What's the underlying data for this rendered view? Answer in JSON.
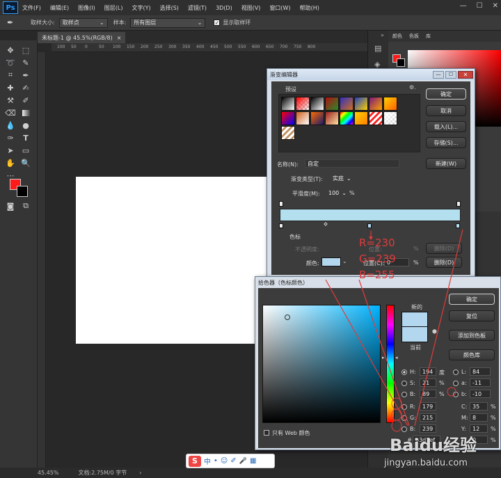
{
  "app": {
    "logo": "Ps"
  },
  "menubar": [
    "文件(F)",
    "编辑(E)",
    "图像(I)",
    "图层(L)",
    "文字(Y)",
    "选择(S)",
    "滤镜(T)",
    "3D(D)",
    "视图(V)",
    "窗口(W)",
    "帮助(H)"
  ],
  "window_controls": [
    "—",
    "☐",
    "✕"
  ],
  "options": {
    "sample_size_label": "取样大小:",
    "sample_size_value": "取样点",
    "sample_label": "样本:",
    "sample_value": "所有图层",
    "show_ring_label": "显示取样环",
    "show_ring_checked": true
  },
  "document": {
    "tab_label": "未标题-1 @ 45.5%(RGB/8)",
    "close": "×",
    "zoom": "45.45%",
    "doc_info": "文档:2.75M/0 字节"
  },
  "ruler": [
    "100",
    "50",
    "0",
    "50",
    "100",
    "150",
    "200",
    "250",
    "300",
    "350",
    "400",
    "450",
    "500",
    "550",
    "600",
    "650",
    "700",
    "750",
    "800"
  ],
  "tools": {
    "foreground": "#ff1a1a",
    "background": "#000000"
  },
  "panel": {
    "tabs": [
      "颜色",
      "色板",
      "库"
    ]
  },
  "gradient_editor": {
    "title": "渐变编辑器",
    "presets_label": "预设",
    "gear": "⚙.",
    "buttons": {
      "ok": "确定",
      "cancel": "取消",
      "load": "载入(L)...",
      "save": "存储(S)...",
      "new": "新建(W)"
    },
    "name_label": "名称(N):",
    "name_value": "自定",
    "type_label": "渐变类型(T):",
    "type_value": "实底",
    "smooth_label": "平滑度(M):",
    "smooth_value": "100",
    "smooth_unit": "%",
    "stops_label": "色标",
    "opacity_label": "不透明度:",
    "location_label": "位置:",
    "delete_label": "删除(D)",
    "color_label": "颜色:",
    "color_location_label": "位置(C):",
    "color_location_value": "0",
    "pct": "%",
    "bar_color": "#b3dfef",
    "swatch_color": "#b3d7ef",
    "presets": [
      {
        "a": "#000000",
        "b": "#ffffff"
      },
      {
        "a": "#ff0000",
        "b": "#ffffff",
        "checker": true
      },
      {
        "a": "#000000",
        "b": "#ffffff"
      },
      {
        "a": "#b01010",
        "b": "#2a8a2a"
      },
      {
        "a": "#3030c0",
        "b": "#d07020"
      },
      {
        "a": "#2040c0",
        "b": "#ffd000"
      },
      {
        "a": "#7a1a7a",
        "b": "#ffa000"
      },
      {
        "a": "#ffd000",
        "b": "#ff6000"
      },
      {
        "a": "#ff0000",
        "b": "#0000ff"
      },
      {
        "a": "#d06020",
        "b": "#ffffff"
      },
      {
        "a": "#ff6a00",
        "b": "#1a1a6a"
      },
      {
        "a": "#9a2020",
        "b": "#ffe0a0"
      },
      {
        "a": "#ff0000",
        "b": "#00ff00",
        "rainbow": true
      },
      {
        "a": "#ffd000",
        "b": "#ff8000"
      },
      {
        "a": "#ffffff",
        "b": "#ff2020",
        "stripes": true
      },
      {
        "a": "#ffffff",
        "b": "#cccccc",
        "checker": true
      },
      {
        "a": "#ffffff",
        "b": "#c09060",
        "stripes": true
      }
    ]
  },
  "color_picker": {
    "title": "拾色器（色标颜色）",
    "new_label": "新的",
    "current_label": "当前",
    "new_color": "#b3d7ef",
    "current_color": "#b3d7ef",
    "buttons": {
      "ok": "确定",
      "reset": "复位",
      "add_swatch": "添加到色板",
      "libraries": "颜色库"
    },
    "web_only_label": "只有 Web 颜色",
    "hsb": [
      {
        "label": "H:",
        "value": "194",
        "unit": "度"
      },
      {
        "label": "S:",
        "value": "21",
        "unit": "%"
      },
      {
        "label": "B:",
        "value": "89",
        "unit": "%"
      }
    ],
    "rgb": [
      {
        "label": "R:",
        "value": "179"
      },
      {
        "label": "G:",
        "value": "215"
      },
      {
        "label": "B:",
        "value": "239"
      }
    ],
    "lab": [
      {
        "label": "L:",
        "value": "84"
      },
      {
        "label": "a:",
        "value": "-11"
      },
      {
        "label": "b:",
        "value": "-10"
      }
    ],
    "cmyk": [
      {
        "label": "C:",
        "value": "35",
        "unit": "%"
      },
      {
        "label": "M:",
        "value": "8",
        "unit": "%"
      },
      {
        "label": "Y:",
        "value": "12",
        "unit": "%"
      },
      {
        "label": "K:",
        "value": "0",
        "unit": "%"
      }
    ],
    "hex_label": "#",
    "hex_value": "b3d7ef",
    "hue_color": "#00b4ff"
  },
  "annotation": {
    "lines": [
      "R=230",
      "G=239",
      "B=255"
    ],
    "color": "#e23b3b"
  },
  "ime": {
    "logo": "S",
    "items": [
      "中",
      "•",
      "☺",
      "✐",
      "🎤",
      "▦"
    ]
  },
  "watermark": {
    "brand": "Baidu经验",
    "url": "jingyan.baidu.com"
  }
}
